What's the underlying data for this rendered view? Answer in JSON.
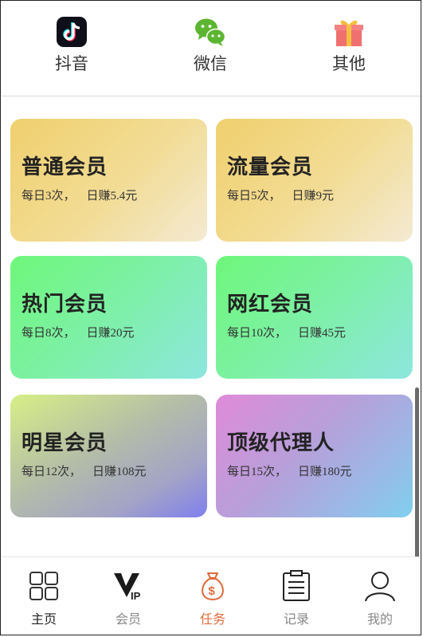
{
  "categories": [
    {
      "label": "抖音",
      "icon": "tiktok-icon"
    },
    {
      "label": "微信",
      "icon": "wechat-icon"
    },
    {
      "label": "其他",
      "icon": "gift-icon"
    }
  ],
  "cards": [
    {
      "title": "普通会员",
      "daily": "每日3次，",
      "earn": "日赚5.4元"
    },
    {
      "title": "流量会员",
      "daily": "每日5次，",
      "earn": "日赚9元"
    },
    {
      "title": "热门会员",
      "daily": "每日8次，",
      "earn": "日赚20元"
    },
    {
      "title": "网红会员",
      "daily": "每日10次，",
      "earn": "日赚45元"
    },
    {
      "title": "明星会员",
      "daily": "每日12次，",
      "earn": "日赚108元"
    },
    {
      "title": "顶级代理人",
      "daily": "每日15次，",
      "earn": "日赚180元"
    }
  ],
  "tabs": [
    {
      "label": "主页",
      "icon": "grid-icon"
    },
    {
      "label": "会员",
      "icon": "vip-icon"
    },
    {
      "label": "任务",
      "icon": "money-bag-icon"
    },
    {
      "label": "记录",
      "icon": "clipboard-icon"
    },
    {
      "label": "我的",
      "icon": "person-icon"
    }
  ],
  "colors": {
    "active_tab": "#e06a3c",
    "inactive_tab": "#888888"
  }
}
